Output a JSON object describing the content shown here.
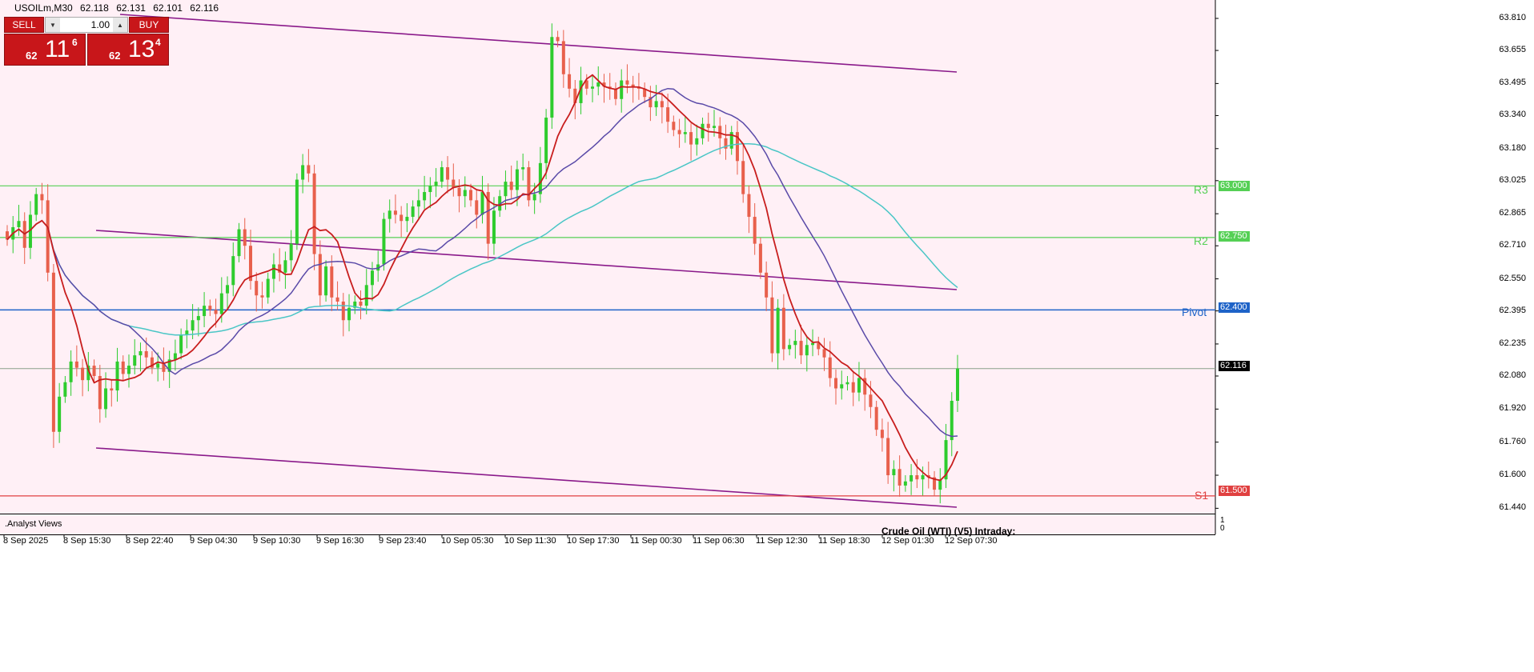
{
  "header": {
    "symbol": "USOILm,M30",
    "open": "62.118",
    "high": "62.131",
    "low": "62.101",
    "close": "62.116"
  },
  "trade_panel": {
    "sell_label": "SELL",
    "buy_label": "BUY",
    "lot": "1.00",
    "sell_price_prefix": "62",
    "sell_price_big": "11",
    "sell_price_sup": "6",
    "buy_price_prefix": "62",
    "buy_price_big": "13",
    "buy_price_sup": "4"
  },
  "levels": {
    "r3": {
      "name": "R3",
      "value": "63.000",
      "color": "#55d055"
    },
    "r2": {
      "name": "R2",
      "value": "62.750",
      "color": "#55d055"
    },
    "pivot": {
      "name": "Pivot",
      "value": "62.400",
      "color": "#1e63c8"
    },
    "s1": {
      "name": "S1",
      "value": "61.500",
      "color": "#e04040"
    },
    "current": {
      "value": "62.116"
    }
  },
  "y_axis_ticks": [
    "63.810",
    "63.655",
    "63.495",
    "63.340",
    "63.180",
    "63.025",
    "62.865",
    "62.710",
    "62.550",
    "62.395",
    "62.235",
    "62.080",
    "61.920",
    "61.760",
    "61.600",
    "61.440"
  ],
  "x_axis_labels": [
    "8 Sep 2025",
    "8 Sep 15:30",
    "8 Sep 22:40",
    "9 Sep 04:30",
    "9 Sep 10:30",
    "9 Sep 16:30",
    "9 Sep 23:40",
    "10 Sep 05:30",
    "10 Sep 11:30",
    "10 Sep 17:30",
    "11 Sep 00:30",
    "11 Sep 06:30",
    "11 Sep 12:30",
    "11 Sep 18:30",
    "12 Sep 01:30",
    "12 Sep 07:30"
  ],
  "subwindow": {
    "name": ".Analyst Views",
    "title": "Crude Oil (WTI) (V5) Intraday:",
    "axis_top": "1",
    "axis_bottom": "0"
  },
  "colors": {
    "background": "#fff0f6",
    "bull": "#2ecc2e",
    "bear": "#e8604c",
    "ma_fast": "#c81e1e",
    "ma_mid": "#5a4aa8",
    "ma_slow": "#4ac6c6",
    "channel": "#8a1a8a"
  },
  "chart_data": {
    "type": "candlestick",
    "title": "USOILm,M30",
    "ylim": [
      61.37,
      63.87
    ],
    "y_ticks": [
      63.81,
      63.655,
      63.495,
      63.34,
      63.18,
      63.025,
      62.865,
      62.71,
      62.55,
      62.395,
      62.235,
      62.08,
      61.92,
      61.76,
      61.6,
      61.44
    ],
    "horizontal_levels": [
      {
        "name": "R3",
        "value": 63.0
      },
      {
        "name": "R2",
        "value": 62.75
      },
      {
        "name": "Pivot",
        "value": 62.4
      },
      {
        "name": "S1",
        "value": 61.5
      },
      {
        "value": 62.116
      }
    ],
    "candles_close": [
      62.74,
      62.8,
      62.83,
      62.7,
      62.86,
      62.96,
      62.93,
      62.58,
      61.81,
      61.98,
      62.05,
      62.15,
      62.12,
      62.06,
      62.13,
      62.08,
      61.92,
      62.02,
      62.01,
      62.15,
      62.09,
      62.13,
      62.18,
      62.2,
      62.17,
      62.12,
      62.14,
      62.1,
      62.16,
      62.19,
      62.28,
      62.3,
      62.35,
      62.37,
      62.42,
      62.4,
      62.38,
      62.48,
      62.52,
      62.66,
      62.79,
      62.71,
      62.54,
      62.47,
      62.46,
      62.55,
      62.62,
      62.58,
      62.64,
      62.72,
      63.03,
      63.1,
      63.06,
      62.67,
      62.47,
      62.61,
      62.46,
      62.44,
      62.35,
      62.41,
      62.44,
      62.42,
      62.52,
      62.59,
      62.62,
      62.84,
      62.88,
      62.86,
      62.83,
      62.85,
      62.9,
      62.93,
      62.97,
      63.0,
      63.02,
      63.09,
      63.03,
      62.99,
      62.95,
      62.98,
      62.93,
      62.86,
      62.97,
      62.72,
      62.88,
      62.95,
      63.02,
      62.98,
      63.08,
      63.09,
      62.93,
      62.96,
      63.11,
      63.33,
      63.72,
      63.7,
      63.54,
      63.47,
      63.4,
      63.51,
      63.47,
      63.48,
      63.5,
      63.48,
      63.47,
      63.42,
      63.51,
      63.49,
      63.48,
      63.47,
      63.43,
      63.38,
      63.41,
      63.38,
      63.31,
      63.27,
      63.25,
      63.26,
      63.2,
      63.23,
      63.3,
      63.28,
      63.29,
      63.23,
      63.18,
      63.26,
      63.12,
      62.96,
      62.85,
      62.72,
      62.58,
      62.46,
      62.19,
      62.41,
      62.21,
      62.23,
      62.25,
      62.18,
      62.23,
      62.24,
      62.21,
      62.17,
      62.07,
      62.02,
      62.04,
      62.05,
      62.0,
      62.07,
      61.99,
      61.93,
      61.82,
      61.78,
      61.6,
      61.63,
      61.55,
      61.57,
      61.6,
      61.58,
      61.6,
      61.59,
      61.53,
      61.58,
      61.77,
      61.96,
      62.116
    ]
  }
}
